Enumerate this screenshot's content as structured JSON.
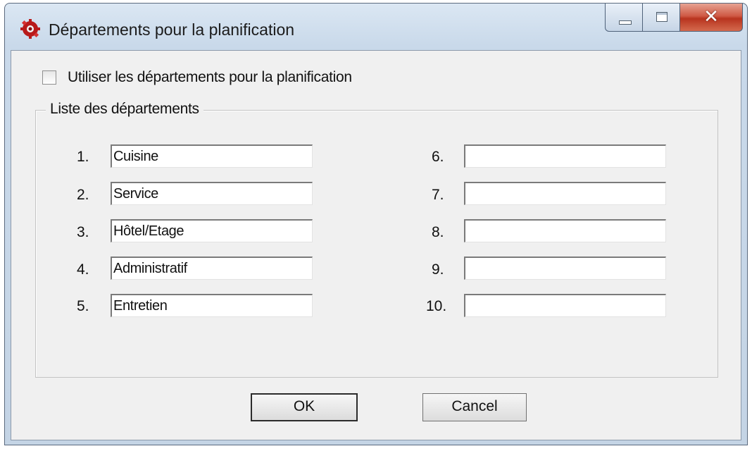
{
  "window": {
    "title": "Départements pour la planification",
    "icon": "red-gear-app-icon",
    "controls": {
      "minimize": "minimize-icon",
      "maximize": "maximize-icon",
      "close": "✕"
    }
  },
  "checkbox": {
    "label": "Utiliser les départements pour la planification",
    "checked": false
  },
  "group": {
    "legend": "Liste des départements",
    "departments": [
      {
        "number": "1.",
        "value": "Cuisine"
      },
      {
        "number": "2.",
        "value": "Service"
      },
      {
        "number": "3.",
        "value": "Hôtel/Etage"
      },
      {
        "number": "4.",
        "value": "Administratif"
      },
      {
        "number": "5.",
        "value": "Entretien"
      },
      {
        "number": "6.",
        "value": ""
      },
      {
        "number": "7.",
        "value": ""
      },
      {
        "number": "8.",
        "value": ""
      },
      {
        "number": "9.",
        "value": ""
      },
      {
        "number": "10.",
        "value": ""
      }
    ]
  },
  "buttons": {
    "ok": "OK",
    "cancel": "Cancel"
  },
  "colors": {
    "close_button": "#c9442e",
    "dialog_background": "#f0f0f0",
    "title_bar": "#c9d9ea"
  }
}
